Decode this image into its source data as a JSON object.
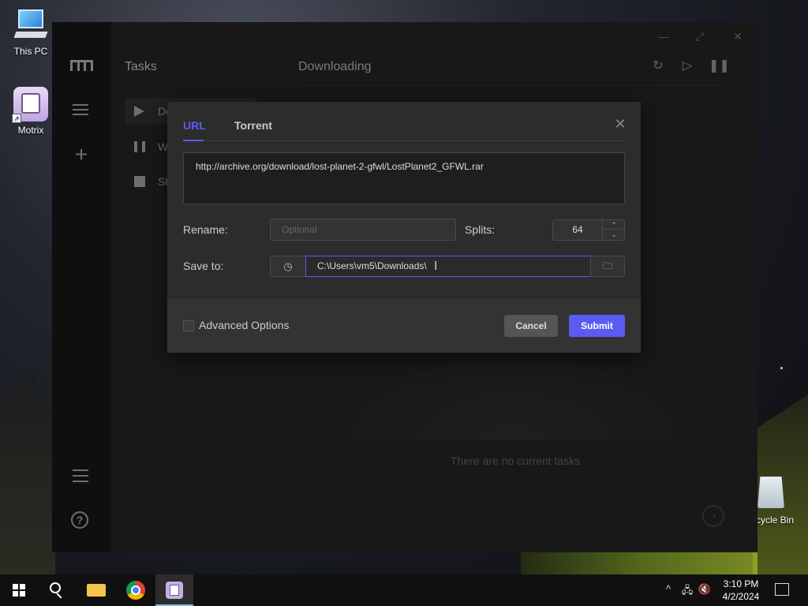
{
  "desktop": {
    "icons": [
      {
        "label": "This PC"
      },
      {
        "label": "Motrix"
      },
      {
        "label": "cycle Bin"
      }
    ]
  },
  "window": {
    "controls": {
      "minimize": "—",
      "maximize": "⤢",
      "close": "✕"
    },
    "nav_rail": {
      "icons": [
        "logo-icon",
        "menu-icon",
        "add-icon",
        "settings-sliders-icon",
        "help-icon"
      ],
      "help_glyph": "?"
    },
    "tasks_panel": {
      "title": "Tasks",
      "items": [
        {
          "label": "Do",
          "icon": "play-icon",
          "active": true
        },
        {
          "label": "W",
          "icon": "pause-icon",
          "active": false
        },
        {
          "label": "St",
          "icon": "stop-icon",
          "active": false
        }
      ]
    },
    "main": {
      "title": "Downloading",
      "toolbar": {
        "refresh": "↻",
        "resume_all": "▷",
        "pause_all": "❚❚"
      },
      "empty_message": "There are no current tasks",
      "speed_glyph": "◔"
    }
  },
  "dialog": {
    "tabs": [
      {
        "label": "URL",
        "active": true
      },
      {
        "label": "Torrent",
        "active": false
      }
    ],
    "close_glyph": "✕",
    "url_value": "http://archive.org/download/lost-planet-2-gfwl/LostPlanet2_GFWL.rar",
    "rename": {
      "label": "Rename:",
      "placeholder": "Optional",
      "value": ""
    },
    "splits": {
      "label": "Splits:",
      "value": "64",
      "up": "⌃",
      "down": "⌄"
    },
    "save_to": {
      "label": "Save to:",
      "history_glyph": "◷",
      "value": "C:\\Users\\vm5\\Downloads\\",
      "cursor": "I",
      "folder_glyph": "🗀"
    },
    "advanced_label": "Advanced Options",
    "cancel_label": "Cancel",
    "submit_label": "Submit"
  },
  "taskbar": {
    "time": "3:10 PM",
    "date": "4/2/2024",
    "tray": {
      "chevron": "^",
      "network": "🖧",
      "volume": "🔇"
    }
  },
  "colors": {
    "accent": "#5b5bf0",
    "window_bg": "#202020",
    "dialog_bg": "#2c2c2c"
  }
}
